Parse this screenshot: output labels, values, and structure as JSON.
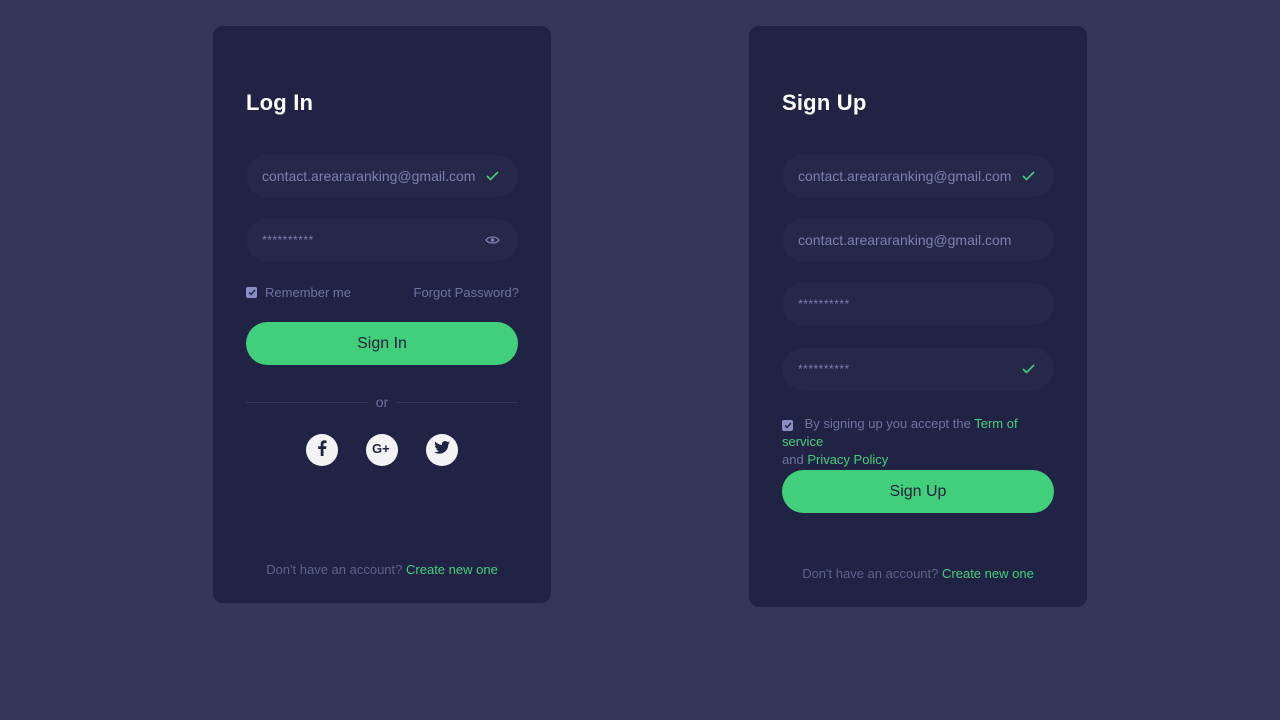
{
  "login": {
    "title": "Log In",
    "email_value": "contact.areararanking@gmail.com",
    "password_value": "**********",
    "remember_label": "Remember me",
    "forgot_label": "Forgot Password?",
    "signin_label": "Sign In",
    "or_label": "or",
    "footer_text": "Don't have an account?",
    "footer_link": "Create new one"
  },
  "signup": {
    "title": "Sign Up",
    "email_value": "contact.areararanking@gmail.com",
    "email2_value": "contact.areararanking@gmail.com",
    "password_value": "**********",
    "confirm_value": "**********",
    "terms_prefix": "By signing up you accept the",
    "terms_link": "Term of service",
    "terms_and": "and",
    "privacy_link": "Privacy Policy",
    "signup_label": "Sign Up",
    "footer_text": "Don't have an account?",
    "footer_link": "Create new one"
  },
  "social": [
    "facebook-icon",
    "google-plus-icon",
    "twitter-icon"
  ],
  "colors": {
    "background": "#34365a",
    "card": "#202343",
    "field": "#252849",
    "accent": "#41cf7c",
    "muted_text": "#6f739f"
  }
}
